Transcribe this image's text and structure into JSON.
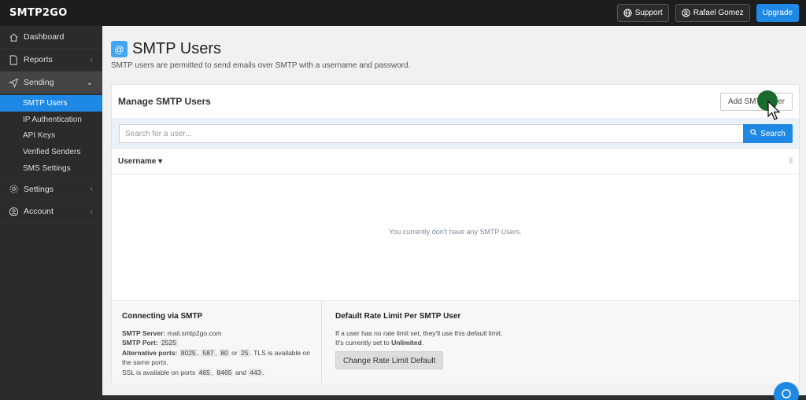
{
  "topbar": {
    "logo": "SMTP2GO",
    "support": "Support",
    "user": "Rafael Gomez",
    "upgrade": "Upgrade"
  },
  "sidebar": {
    "items": [
      {
        "label": "Dashboard",
        "icon": "home-icon"
      },
      {
        "label": "Reports",
        "icon": "document-icon"
      },
      {
        "label": "Sending",
        "icon": "paper-plane-icon"
      },
      {
        "label": "Settings",
        "icon": "gear-icon"
      },
      {
        "label": "Account",
        "icon": "user-circle-icon"
      }
    ],
    "sending_sub": [
      "SMTP Users",
      "IP Authentication",
      "API Keys",
      "Verified Senders",
      "SMS Settings"
    ]
  },
  "page": {
    "title": "SMTP Users",
    "subtitle": "SMTP users are permitted to send emails over SMTP with a username and password."
  },
  "card": {
    "title": "Manage SMTP Users",
    "add_button": "Add SMTP User",
    "search_placeholder": "Search for a user...",
    "search_button": "Search",
    "column_username": "Username",
    "empty_message": "You currently don't have any SMTP Users."
  },
  "connecting": {
    "title": "Connecting via SMTP",
    "server_label": "SMTP Server:",
    "server_value": "mail.smtp2go.com",
    "port_label": "SMTP Port:",
    "port_value": "2525",
    "alt_label": "Alternative ports:",
    "alt_ports": [
      "8025",
      "587",
      "80",
      "25"
    ],
    "alt_or": "or",
    "tls_note": ". TLS is available on the same ports.",
    "ssl_prefix": "SSL is available on ports",
    "ssl_ports": [
      "465",
      "8465",
      "443"
    ],
    "ssl_and": "and"
  },
  "rate_limit": {
    "title": "Default Rate Limit Per SMTP User",
    "line1": "If a user has no rate limit set, they'll use this default limit.",
    "line2_prefix": "It's currently set to",
    "line2_value": "Unlimited",
    "button": "Change Rate Limit Default"
  },
  "colors": {
    "accent": "#1e88e5",
    "sidebar_bg": "#2b2b2b",
    "topbar_bg": "#1d1d1d"
  }
}
